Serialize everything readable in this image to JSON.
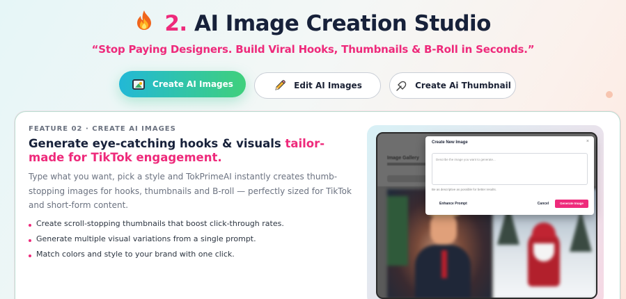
{
  "header": {
    "icon": "fire-icon",
    "number": "2.",
    "title": "AI Image Creation Studio",
    "tagline": "“Stop Paying Designers. Build Viral Hooks, Thumbnails & B-Roll in Seconds.”"
  },
  "tabs": [
    {
      "label": "Create AI Images",
      "icon": "image-icon",
      "active": true
    },
    {
      "label": "Edit AI Images",
      "icon": "pencil-icon",
      "active": false
    },
    {
      "label": "Create Ai Thumbnail",
      "icon": "pin-icon",
      "active": false
    }
  ],
  "feature": {
    "kicker": "FEATURE 02 · CREATE AI IMAGES",
    "heading_plain": "Generate eye-catching hooks & visuals ",
    "heading_highlight": "tailor-made for TikTok engagement.",
    "description": "Type what you want, pick a style and TokPrimeAI instantly creates thumb-stopping images for hooks, thumbnails and B-roll — perfectly sized for TikTok and short-form content.",
    "bullets": [
      "Create scroll-stopping thumbnails that boost click-through rates.",
      "Generate multiple visual variations from a single prompt.",
      "Match colors and style to your brand with one click."
    ]
  },
  "preview": {
    "gallery_title": "Image Gallery",
    "modal": {
      "title": "Create New Image",
      "close": "×",
      "placeholder": "Describe the image you want to generate...",
      "hint": "Be as descriptive as possible for better results.",
      "enhance": "Enhance Prompt",
      "cancel": "Cancel",
      "generate": "Generate Image"
    }
  },
  "colors": {
    "accent": "#ee2a7b",
    "active_tab_start": "#22b8d6",
    "active_tab_end": "#3fd07c"
  }
}
